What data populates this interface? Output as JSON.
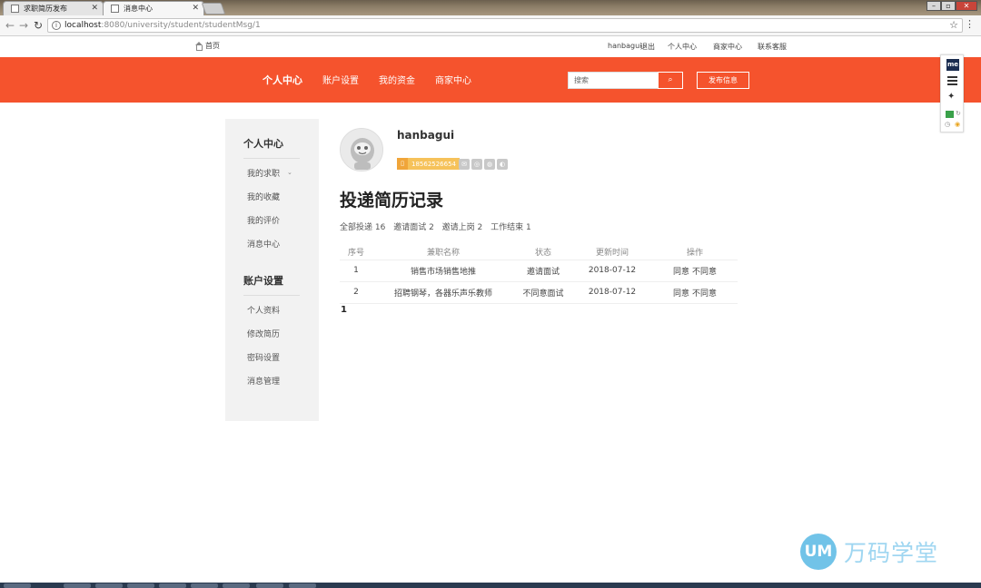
{
  "browser": {
    "tabs": [
      {
        "title": "求职简历发布",
        "active": false
      },
      {
        "title": "消息中心",
        "active": true
      }
    ],
    "url_host": "localhost",
    "url_path": ":8080/university/student/studentMsg/1"
  },
  "topbar": {
    "home": "首页",
    "username": "hanbagui",
    "logout": "退出",
    "personal_center": "个人中心",
    "merchant_center": "商家中心",
    "customer_service": "联系客服"
  },
  "mainnav": {
    "items": [
      "个人中心",
      "账户设置",
      "我的资金",
      "商家中心"
    ],
    "search_placeholder": "搜索",
    "publish": "发布信息"
  },
  "extension": {
    "badge": "me"
  },
  "sidebar": {
    "section1_title": "个人中心",
    "section1_items": [
      "我的求职",
      "我的收藏",
      "我的评价",
      "消息中心"
    ],
    "section2_title": "账户设置",
    "section2_items": [
      "个人资料",
      "修改简历",
      "密码设置",
      "消息管理"
    ]
  },
  "profile": {
    "name": "hanbagui",
    "phone": "18562526654"
  },
  "page": {
    "heading": "投递简历记录",
    "stats": [
      "全部投递 16",
      "邀请面试 2",
      "邀请上岗 2",
      "工作结束 1"
    ]
  },
  "table": {
    "headers": [
      "序号",
      "兼职名称",
      "状态",
      "更新时间",
      "操作"
    ],
    "rows": [
      {
        "no": "1",
        "name": "销售市场销售地推",
        "status": "邀请面试",
        "time": "2018-07-12",
        "agree": "同意",
        "disagree": "不同意"
      },
      {
        "no": "2",
        "name": "招聘钢琴，各器乐声乐教师",
        "status": "不同意面试",
        "time": "2018-07-12",
        "agree": "同意",
        "disagree": "不同意"
      }
    ]
  },
  "pager": {
    "current": "1"
  },
  "watermark": {
    "logo": "UM",
    "text": "万码学堂"
  },
  "colors": {
    "brand": "#f5532d",
    "badge": "#f6c25a",
    "sidebar_bg": "#f2f2f2"
  }
}
